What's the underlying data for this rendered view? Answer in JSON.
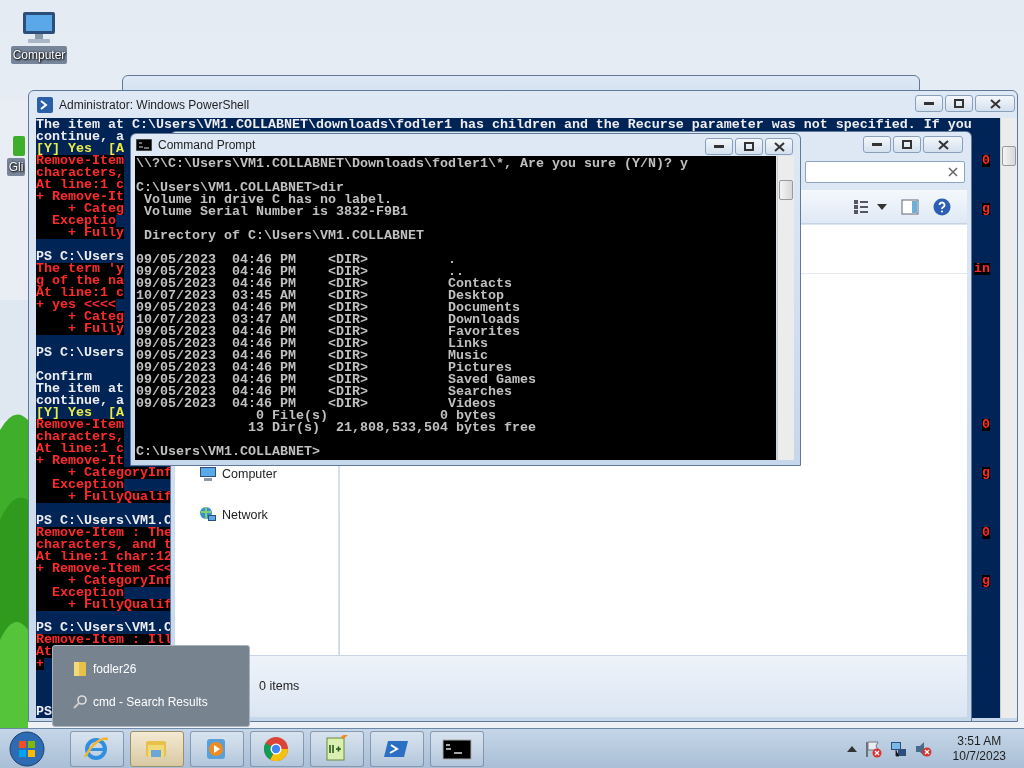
{
  "desktop_icons": [
    {
      "kind": "computer",
      "label": "Computer"
    },
    {
      "kind": "app",
      "label": "Gli"
    }
  ],
  "powershell": {
    "title": "Administrator: Windows PowerShell",
    "lines": [
      {
        "kind": "text",
        "text": "The item at C:\\Users\\VM1.COLLABNET\\downloads\\fodler1 has children and the Recurse parameter was not specified. If you"
      },
      {
        "kind": "text",
        "text": "continue, a"
      },
      {
        "kind": "prompt",
        "text": "[Y] Yes  [A"
      },
      {
        "kind": "error",
        "text": "Remove-Item",
        "tail": "0"
      },
      {
        "kind": "error",
        "text": "characters,"
      },
      {
        "kind": "error",
        "text": "At line:1 c"
      },
      {
        "kind": "error",
        "text": "+ Remove-It"
      },
      {
        "kind": "error",
        "text": "    + Categ",
        "tail": "g"
      },
      {
        "kind": "error",
        "text": "  Exceptio"
      },
      {
        "kind": "error",
        "text": "    + Fully"
      },
      {
        "kind": "blank"
      },
      {
        "kind": "text",
        "text": "PS C:\\Users"
      },
      {
        "kind": "error",
        "text": "The term 'y",
        "tail": "in"
      },
      {
        "kind": "error",
        "text": "g of the na"
      },
      {
        "kind": "error",
        "text": "At line:1 c"
      },
      {
        "kind": "error",
        "text": "+ yes <<<<"
      },
      {
        "kind": "error",
        "text": "    + Categ"
      },
      {
        "kind": "error",
        "text": "    + Fully"
      },
      {
        "kind": "blank"
      },
      {
        "kind": "text",
        "text": "PS C:\\Users"
      },
      {
        "kind": "blank"
      },
      {
        "kind": "text",
        "text": "Confirm"
      },
      {
        "kind": "text",
        "text": "The item at"
      },
      {
        "kind": "text",
        "text": "continue, a"
      },
      {
        "kind": "prompt",
        "text": "[Y] Yes  [A"
      },
      {
        "kind": "error",
        "text": "Remove-Item",
        "tail": "0"
      },
      {
        "kind": "error",
        "text": "characters,"
      },
      {
        "kind": "error",
        "text": "At line:1 c"
      },
      {
        "kind": "error",
        "text": "+ Remove-It"
      },
      {
        "kind": "error",
        "text": "    + CategoryInf",
        "tail": "g"
      },
      {
        "kind": "error",
        "text": "  Exception"
      },
      {
        "kind": "error",
        "text": "    + FullyQualif"
      },
      {
        "kind": "blank"
      },
      {
        "kind": "text",
        "text": "PS C:\\Users\\VM1.C"
      },
      {
        "kind": "error",
        "text": "Remove-Item : The",
        "tail": "0"
      },
      {
        "kind": "error",
        "text": "characters, and t"
      },
      {
        "kind": "error",
        "text": "At line:1 char:12"
      },
      {
        "kind": "error",
        "text": "+ Remove-Item <<<"
      },
      {
        "kind": "error",
        "text": "    + CategoryInf",
        "tail": "g"
      },
      {
        "kind": "error",
        "text": "  Exception"
      },
      {
        "kind": "error",
        "text": "    + FullyQualif"
      },
      {
        "kind": "blank"
      },
      {
        "kind": "text",
        "text": "PS C:\\Users\\VM1.C"
      },
      {
        "kind": "error",
        "text": "Remove-Item : Ill"
      },
      {
        "kind": "error",
        "text": "At"
      },
      {
        "kind": "error",
        "text": "+"
      },
      {
        "kind": "blank"
      },
      {
        "kind": "blank"
      },
      {
        "kind": "blank"
      },
      {
        "kind": "text",
        "text": "PS"
      }
    ]
  },
  "explorer": {
    "nav_items": [
      {
        "kind": "computer",
        "label": "Computer"
      },
      {
        "kind": "network",
        "label": "Network"
      }
    ],
    "status": "0 items"
  },
  "cmd": {
    "title": "Command Prompt",
    "lines": [
      {
        "kind": "text",
        "text": "\\\\?\\C:\\Users\\VM1.COLLABNET\\Downloads\\fodler1\\*, Are you sure (Y/N)? y"
      },
      {
        "kind": "blank"
      },
      {
        "kind": "text",
        "text": "C:\\Users\\VM1.COLLABNET>dir"
      },
      {
        "kind": "text",
        "text": " Volume in drive C has no label."
      },
      {
        "kind": "text",
        "text": " Volume Serial Number is 3832-F9B1"
      },
      {
        "kind": "blank"
      },
      {
        "kind": "text",
        "text": " Directory of C:\\Users\\VM1.COLLABNET"
      },
      {
        "kind": "blank"
      },
      {
        "kind": "text",
        "text": "09/05/2023  04:46 PM    <DIR>          ."
      },
      {
        "kind": "text",
        "text": "09/05/2023  04:46 PM    <DIR>          .."
      },
      {
        "kind": "text",
        "text": "09/05/2023  04:46 PM    <DIR>          Contacts"
      },
      {
        "kind": "text",
        "text": "10/07/2023  03:45 AM    <DIR>          Desktop"
      },
      {
        "kind": "text",
        "text": "09/05/2023  04:46 PM    <DIR>          Documents"
      },
      {
        "kind": "text",
        "text": "10/07/2023  03:47 AM    <DIR>          Downloads"
      },
      {
        "kind": "text",
        "text": "09/05/2023  04:46 PM    <DIR>          Favorites"
      },
      {
        "kind": "text",
        "text": "09/05/2023  04:46 PM    <DIR>          Links"
      },
      {
        "kind": "text",
        "text": "09/05/2023  04:46 PM    <DIR>          Music"
      },
      {
        "kind": "text",
        "text": "09/05/2023  04:46 PM    <DIR>          Pictures"
      },
      {
        "kind": "text",
        "text": "09/05/2023  04:46 PM    <DIR>          Saved Games"
      },
      {
        "kind": "text",
        "text": "09/05/2023  04:46 PM    <DIR>          Searches"
      },
      {
        "kind": "text",
        "text": "09/05/2023  04:46 PM    <DIR>          Videos"
      },
      {
        "kind": "text",
        "text": "               0 File(s)              0 bytes"
      },
      {
        "kind": "text",
        "text": "              13 Dir(s)  21,808,533,504 bytes free"
      },
      {
        "kind": "blank"
      },
      {
        "kind": "text",
        "text": "C:\\Users\\VM1.COLLABNET>"
      }
    ]
  },
  "jump_list": {
    "items": [
      {
        "kind": "folder",
        "label": "fodler26"
      },
      {
        "kind": "search",
        "label": "cmd - Search Results"
      }
    ]
  },
  "taskbar": {
    "buttons": [
      {
        "kind": "ie",
        "selected": false
      },
      {
        "kind": "explorer",
        "selected": true
      },
      {
        "kind": "media",
        "selected": false
      },
      {
        "kind": "chrome",
        "selected": false
      },
      {
        "kind": "notepad",
        "selected": false
      },
      {
        "kind": "powershell",
        "selected": false
      },
      {
        "kind": "cmd",
        "selected": false
      }
    ],
    "tray_icons": [
      {
        "kind": "arrow"
      },
      {
        "kind": "flag"
      },
      {
        "kind": "network"
      },
      {
        "kind": "volume"
      }
    ],
    "time": "3:51 AM",
    "date": "10/7/2023"
  }
}
